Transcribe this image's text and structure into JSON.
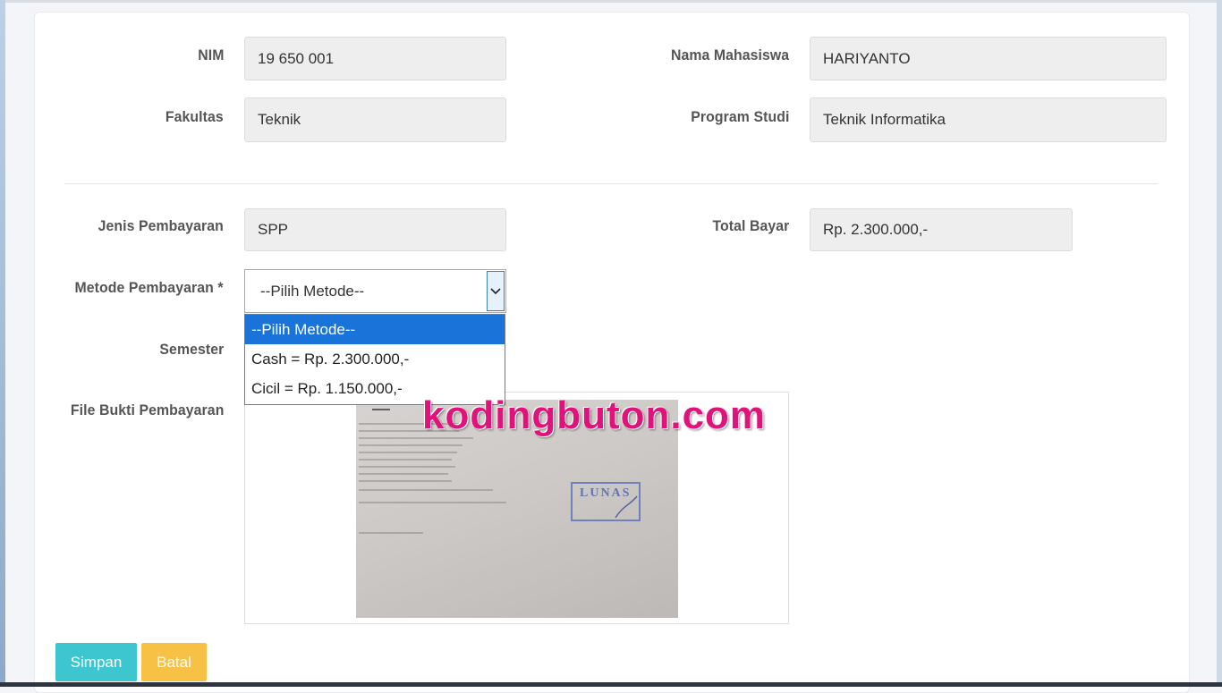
{
  "form": {
    "nim": {
      "label": "NIM",
      "value": "19 650 001"
    },
    "nama_mahasiswa": {
      "label": "Nama Mahasiswa",
      "value": "HARIYANTO"
    },
    "fakultas": {
      "label": "Fakultas",
      "value": "Teknik"
    },
    "program_studi": {
      "label": "Program Studi",
      "value": "Teknik Informatika"
    },
    "jenis_pembayaran": {
      "label": "Jenis Pembayaran",
      "value": "SPP"
    },
    "total_bayar": {
      "label": "Total Bayar",
      "value": "Rp. 2.300.000,-"
    },
    "metode_pembayaran": {
      "label": "Metode Pembayaran *",
      "selected": "--Pilih Metode--",
      "options": [
        "--Pilih Metode--",
        "Cash = Rp. 2.300.000,-",
        "Cicil = Rp. 1.150.000,-"
      ]
    },
    "semester": {
      "label": "Semester"
    },
    "file_bukti": {
      "label": "File Bukti Pembayaran",
      "stamp_text": "LUNAS"
    }
  },
  "buttons": {
    "simpan": "Simpan",
    "batal": "Batal"
  },
  "watermark": "kodingbuton.com",
  "colors": {
    "simpan": "#3dc6cf",
    "batal": "#f6c144",
    "option_selected": "#1a73d8",
    "watermark": "#e0137a"
  }
}
